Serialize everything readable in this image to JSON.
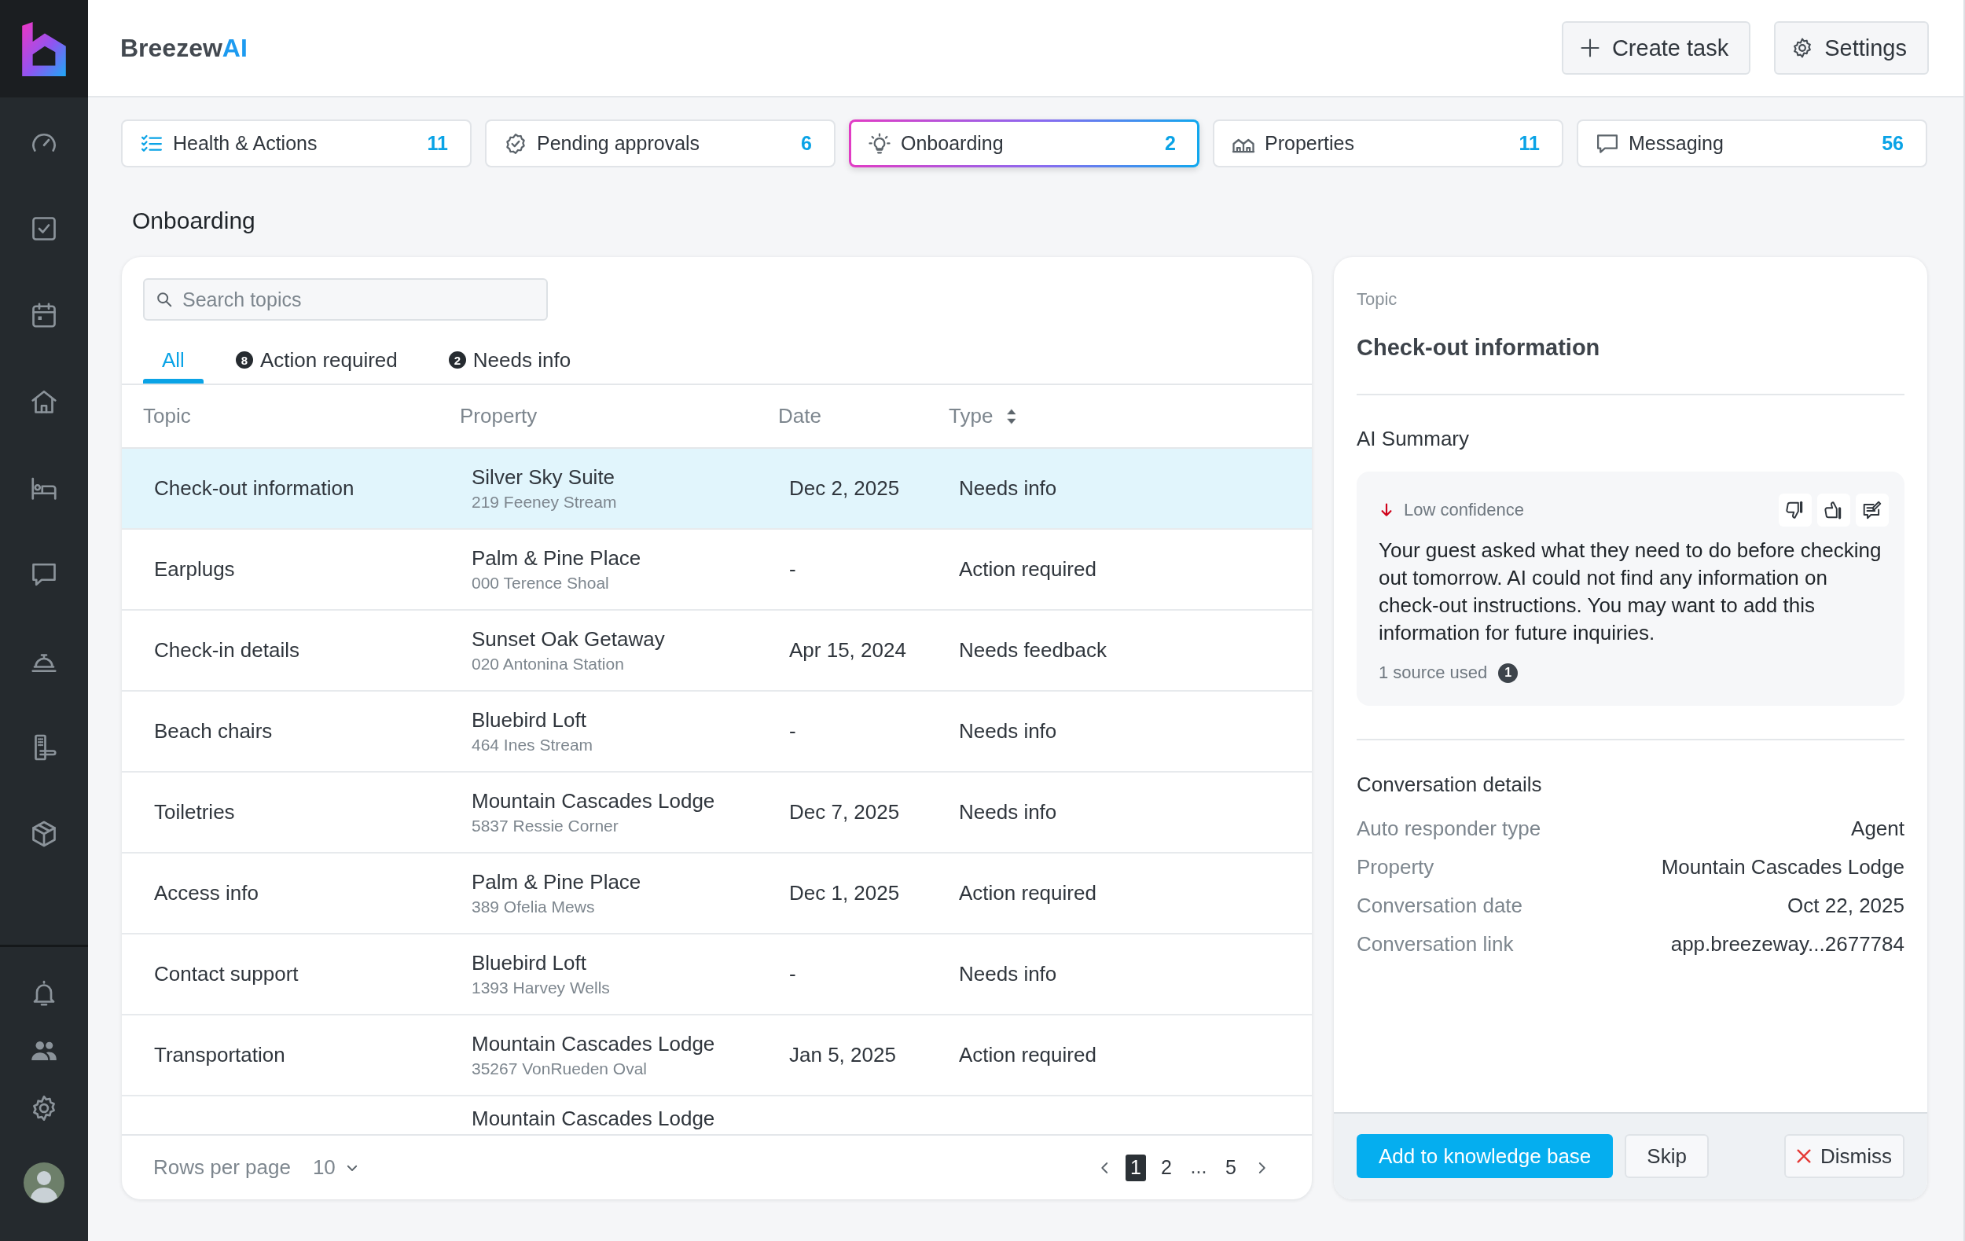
{
  "brand": {
    "text": "Breezew",
    "accent": "AI"
  },
  "header_buttons": [
    {
      "label": "Create task",
      "kind": "create"
    },
    {
      "label": "Settings",
      "kind": "settings"
    }
  ],
  "tabs": [
    {
      "label": "Health & Actions",
      "count": "11",
      "selected": false
    },
    {
      "label": "Pending approvals",
      "count": "6",
      "selected": false
    },
    {
      "label": "Onboarding",
      "count": "2",
      "selected": true
    },
    {
      "label": "Properties",
      "count": "11",
      "selected": false
    },
    {
      "label": "Messaging",
      "count": "56",
      "selected": false
    }
  ],
  "page_title": "Onboarding",
  "topics": {
    "search": {
      "placeholder": "Search topics"
    },
    "filters": [
      {
        "label": "All",
        "selected": true
      },
      {
        "label": "Action required",
        "count": "8",
        "selected": false
      },
      {
        "label": "Needs info",
        "count": "2",
        "selected": false
      }
    ],
    "columns": [
      {
        "label": "Topic",
        "sortable": false
      },
      {
        "label": "Property",
        "sortable": false
      },
      {
        "label": "Date",
        "sortable": false
      },
      {
        "label": "Type",
        "sortable": true
      }
    ],
    "rows": [
      {
        "topic": "Check-out information",
        "property": "Silver Sky Suite",
        "address": "219 Feeney Stream",
        "date": "Dec 2, 2025",
        "type": "Needs info",
        "selected": true
      },
      {
        "topic": "Earplugs",
        "property": "Palm & Pine Place",
        "address": "000 Terence Shoal",
        "date": "-",
        "type": "Action required",
        "selected": false
      },
      {
        "topic": "Check-in details",
        "property": "Sunset Oak Getaway",
        "address": "020 Antonina Station",
        "date": "Apr 15, 2024",
        "type": "Needs feedback",
        "selected": false
      },
      {
        "topic": "Beach chairs",
        "property": "Bluebird Loft",
        "address": "464 Ines Stream",
        "date": "-",
        "type": "Needs info",
        "selected": false
      },
      {
        "topic": "Toiletries",
        "property": "Mountain Cascades Lodge",
        "address": "5837 Ressie Corner",
        "date": "Dec 7, 2025",
        "type": "Needs info",
        "selected": false
      },
      {
        "topic": "Access info",
        "property": "Palm & Pine Place",
        "address": "389 Ofelia Mews",
        "date": "Dec 1, 2025",
        "type": "Action required",
        "selected": false
      },
      {
        "topic": "Contact support",
        "property": "Bluebird Loft",
        "address": "1393 Harvey Wells",
        "date": "-",
        "type": "Needs info",
        "selected": false
      },
      {
        "topic": "Transportation",
        "property": "Mountain Cascades Lodge",
        "address": "35267 VonRueden Oval",
        "date": "Jan 5, 2025",
        "type": "Action required",
        "selected": false
      },
      {
        "property": "Mountain Cascades Lodge",
        "selected": false
      }
    ],
    "footer": {
      "rows_per_page_label": "Rows per page",
      "rows_per_page": "10",
      "pages": [
        {
          "label": "1",
          "kind": "page",
          "selected": true
        },
        {
          "label": "2",
          "kind": "page",
          "selected": false
        },
        {
          "label": "...",
          "kind": "gap",
          "selected": false
        },
        {
          "label": "5",
          "kind": "page",
          "selected": false
        }
      ]
    }
  },
  "detail": {
    "topic_label": "Topic",
    "topic": "Check-out information",
    "summary_heading": "AI Summary",
    "summary": {
      "confidence": "Low confidence",
      "text": "Your guest asked what they need to do before checking out tomorrow. AI could not find any information on check-out instructions. You may want to add this information for future inquiries.",
      "sources": "1 source used",
      "source_count": "1"
    },
    "conversation_heading": "Conversation details",
    "conversation": [
      {
        "label": "Auto responder type",
        "value": "Agent"
      },
      {
        "label": "Property",
        "value": "Mountain Cascades Lodge"
      },
      {
        "label": "Conversation date",
        "value": "Oct 22, 2025"
      },
      {
        "label": "Conversation link",
        "value": "app.breezeway...2677784"
      }
    ],
    "actions": [
      {
        "label": "Add to knowledge base",
        "kind": "primary"
      },
      {
        "label": "Skip",
        "kind": "secondary"
      },
      {
        "label": "Dismiss",
        "kind": "dismiss"
      }
    ]
  }
}
